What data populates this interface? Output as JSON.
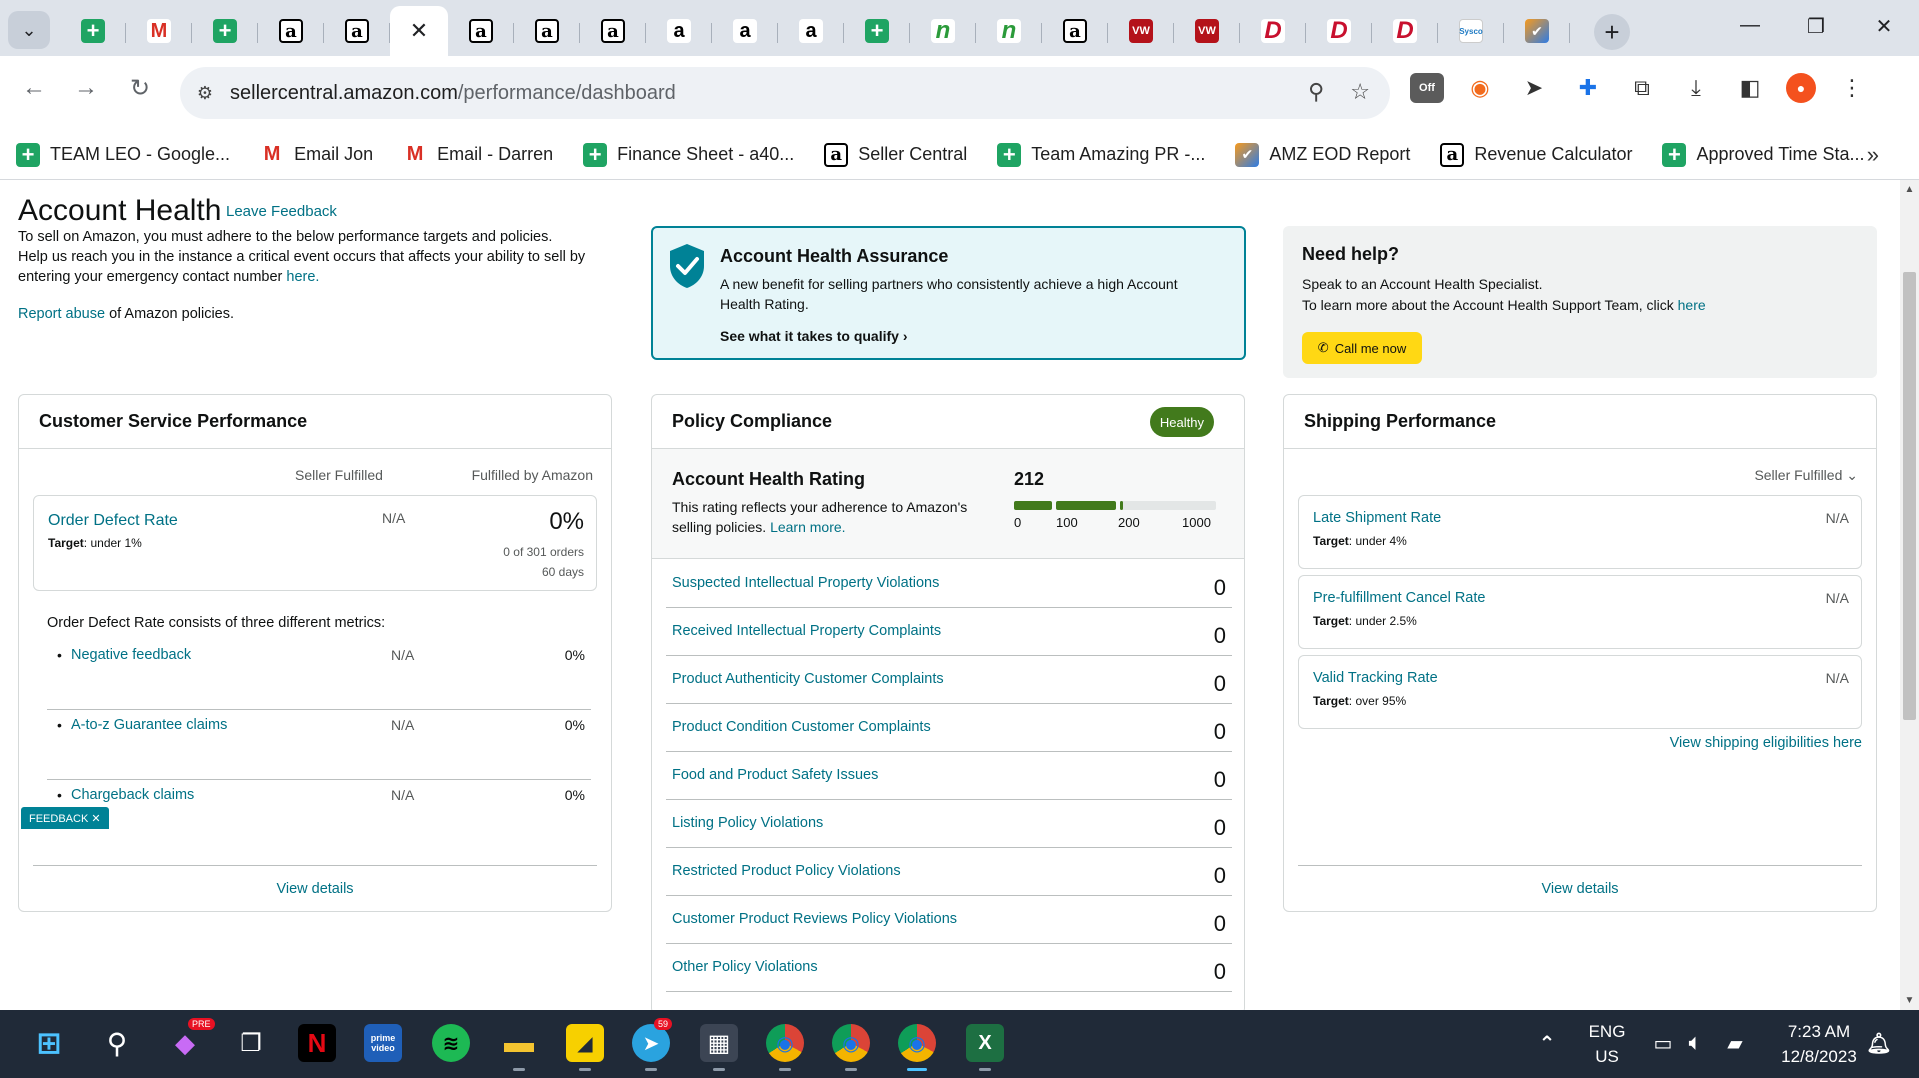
{
  "browser": {
    "tabs": [
      {
        "icon": "sheets-icon",
        "glyph": "+"
      },
      {
        "icon": "gmail-icon",
        "glyph": "M"
      },
      {
        "icon": "sheets-icon",
        "glyph": "+"
      },
      {
        "icon": "amazon-icon",
        "glyph": "a"
      },
      {
        "icon": "amazon-icon",
        "glyph": "a"
      },
      {
        "icon": "close-icon",
        "glyph": "✕",
        "active": true
      },
      {
        "icon": "amazon-icon",
        "glyph": "a"
      },
      {
        "icon": "amazon-icon",
        "glyph": "a"
      },
      {
        "icon": "amazon-icon",
        "glyph": "a"
      },
      {
        "icon": "amazon-white-icon",
        "glyph": "a"
      },
      {
        "icon": "amazon-white-icon",
        "glyph": "a"
      },
      {
        "icon": "amazon-white-icon",
        "glyph": "a"
      },
      {
        "icon": "sheets-icon",
        "glyph": "+"
      },
      {
        "icon": "n-logo-icon",
        "glyph": "n"
      },
      {
        "icon": "n-logo-icon",
        "glyph": "n"
      },
      {
        "icon": "amazon-icon",
        "glyph": "a"
      },
      {
        "icon": "vw-icon",
        "glyph": "VW"
      },
      {
        "icon": "vw-icon",
        "glyph": "VW"
      },
      {
        "icon": "d-logo-icon",
        "glyph": "D"
      },
      {
        "icon": "d-logo-icon",
        "glyph": "D"
      },
      {
        "icon": "d-logo-icon",
        "glyph": "D"
      },
      {
        "icon": "sysco-icon",
        "glyph": "Sysco"
      },
      {
        "icon": "eod-icon",
        "glyph": "✔"
      }
    ],
    "url_host": "sellercentral.amazon.com",
    "url_path": "/performance/dashboard",
    "ext_off_label": "Off",
    "bookmarks": [
      {
        "label": "TEAM LEO - Google...",
        "icon": "sheets-icon",
        "glyph": "+"
      },
      {
        "label": "Email Jon",
        "icon": "gmail-icon",
        "glyph": "M"
      },
      {
        "label": "Email - Darren",
        "icon": "gmail-icon",
        "glyph": "M"
      },
      {
        "label": "Finance Sheet - a40...",
        "icon": "sheets-icon",
        "glyph": "+"
      },
      {
        "label": "Seller Central",
        "icon": "amazon-icon",
        "glyph": "a"
      },
      {
        "label": "Team Amazing PR -...",
        "icon": "sheets-icon",
        "glyph": "+"
      },
      {
        "label": "AMZ EOD Report",
        "icon": "eod-icon",
        "glyph": "✔"
      },
      {
        "label": "Revenue Calculator",
        "icon": "amazon-icon",
        "glyph": "a"
      },
      {
        "label": "Approved Time Sta...",
        "icon": "sheets-icon",
        "glyph": "+"
      }
    ]
  },
  "header": {
    "title": "Account Health",
    "leave_feedback": "Leave Feedback",
    "intro_1": "To sell on Amazon, you must adhere to the below performance targets and policies.",
    "intro_2": "Help us reach you in the instance a critical event occurs that affects your ability to sell by entering your emergency contact number",
    "intro_link": "here.",
    "report_abuse": "Report abuse",
    "report_abuse_suffix": " of Amazon policies."
  },
  "assurance": {
    "title": "Account Health Assurance",
    "description": "A new benefit for selling partners who consistently achieve a high Account Health Rating.",
    "link": "See what it takes to qualify"
  },
  "help": {
    "title": "Need help?",
    "line1": "Speak to an Account Health Specialist.",
    "line2": "To learn more about the Account Health Support Team, click",
    "line2_link": "here",
    "call_button": "Call me now"
  },
  "customer_service": {
    "title": "Customer Service Performance",
    "col_seller": "Seller Fulfilled",
    "col_fba": "Fulfilled by Amazon",
    "odr_name": "Order Defect Rate",
    "odr_target_label": "Target",
    "odr_target": ": under 1%",
    "odr_seller": "N/A",
    "odr_fba": "0%",
    "odr_orders": "0 of 301 orders",
    "odr_days": "60 days",
    "consists": "Order Defect Rate consists of three different metrics:",
    "metrics": [
      {
        "name": "Negative feedback",
        "seller": "N/A",
        "fba": "0%"
      },
      {
        "name": "A-to-z Guarantee claims",
        "seller": "N/A",
        "fba": "0%"
      },
      {
        "name": "Chargeback claims",
        "seller": "N/A",
        "fba": "0%"
      }
    ],
    "view_details": "View details"
  },
  "policy": {
    "title": "Policy Compliance",
    "badge": "Healthy",
    "rating_title": "Account Health Rating",
    "rating_desc": "This rating reflects your adherence to Amazon's selling policies.",
    "rating_link": "Learn more.",
    "rating_value": "212",
    "ticks": [
      "0",
      "100",
      "200",
      "1000"
    ],
    "violations": [
      {
        "name": "Suspected Intellectual Property Violations",
        "count": "0"
      },
      {
        "name": "Received Intellectual Property Complaints",
        "count": "0"
      },
      {
        "name": "Product Authenticity Customer Complaints",
        "count": "0"
      },
      {
        "name": "Product Condition Customer Complaints",
        "count": "0"
      },
      {
        "name": "Food and Product Safety Issues",
        "count": "0"
      },
      {
        "name": "Listing Policy Violations",
        "count": "0"
      },
      {
        "name": "Restricted Product Policy Violations",
        "count": "0"
      },
      {
        "name": "Customer Product Reviews Policy Violations",
        "count": "0"
      },
      {
        "name": "Other Policy Violations",
        "count": "0"
      }
    ]
  },
  "shipping": {
    "title": "Shipping Performance",
    "filter": "Seller Fulfilled",
    "metrics": [
      {
        "name": "Late Shipment Rate",
        "target_label": "Target",
        "target": ": under 4%",
        "value": "N/A"
      },
      {
        "name": "Pre-fulfillment Cancel Rate",
        "target_label": "Target",
        "target": ": under 2.5%",
        "value": "N/A"
      },
      {
        "name": "Valid Tracking Rate",
        "target_label": "Target",
        "target": ": over 95%",
        "value": "N/A"
      }
    ],
    "eligibility_link": "View shipping eligibilities here",
    "view_details": "View details"
  },
  "feedback_tab": "FEEDBACK ✕",
  "taskbar": {
    "apps": [
      {
        "name": "start-icon",
        "glyph": "⊞"
      },
      {
        "name": "search-icon",
        "glyph": "⚲"
      },
      {
        "name": "copilot-icon",
        "glyph": "◆",
        "badge": "PRE"
      },
      {
        "name": "task-view-icon",
        "glyph": "❐"
      },
      {
        "name": "netflix-icon",
        "glyph": "N"
      },
      {
        "name": "prime-video-icon",
        "glyph": "prime video"
      },
      {
        "name": "spotify-icon",
        "glyph": "≋"
      },
      {
        "name": "file-explorer-icon",
        "glyph": "▬"
      },
      {
        "name": "sticky-notes-icon",
        "glyph": "◢"
      },
      {
        "name": "telegram-icon",
        "glyph": "➤",
        "badge": "59"
      },
      {
        "name": "calculator-icon",
        "glyph": "▦"
      },
      {
        "name": "chrome-icon",
        "glyph": "◉"
      },
      {
        "name": "chrome-icon",
        "glyph": "◉"
      },
      {
        "name": "chrome-icon",
        "glyph": "◉"
      },
      {
        "name": "excel-icon",
        "glyph": "X"
      }
    ],
    "lang_1": "ENG",
    "lang_2": "US",
    "time": "7:23 AM",
    "date": "12/8/2023"
  },
  "colors": {
    "link": "#007185",
    "healthy_badge": "#427a1c",
    "assurance_border": "#008296",
    "call_button": "#ffd814"
  }
}
